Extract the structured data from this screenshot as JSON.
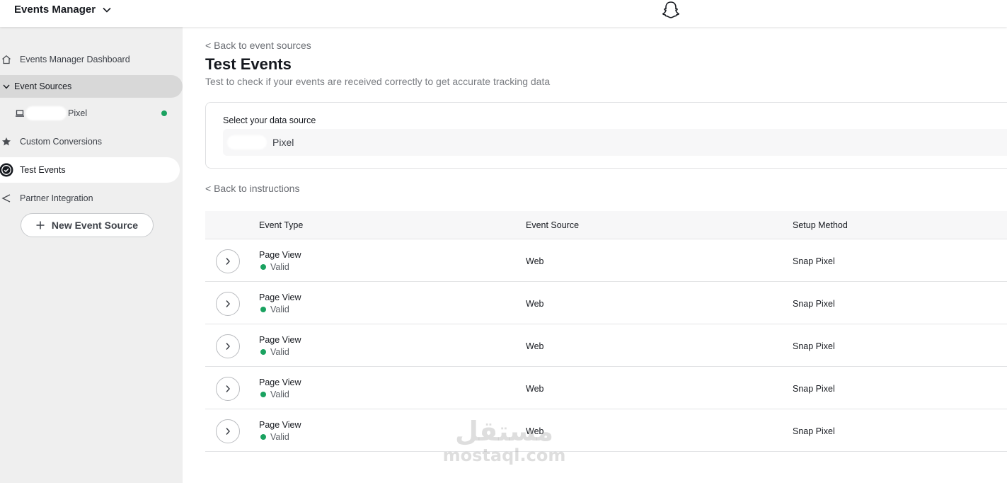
{
  "header": {
    "app_title": "Events Manager",
    "icons": [
      "chevron-down-icon",
      "snapchat-ghost-icon"
    ]
  },
  "sidebar": {
    "items": [
      {
        "label": "Events Manager Dashboard",
        "icon": "home-icon"
      },
      {
        "label": "Event Sources",
        "icon": "chevron-down-icon"
      },
      {
        "label": "Pixel",
        "icon": "laptop-icon",
        "status": "active"
      },
      {
        "label": "Custom Conversions",
        "icon": "star-icon"
      },
      {
        "label": "Test Events",
        "icon": "check-circle-icon"
      },
      {
        "label": "Partner Integration",
        "icon": "share-icon"
      }
    ],
    "new_button_label": "New Event Source"
  },
  "main": {
    "back_to_sources": "< Back to event sources",
    "title": "Test Events",
    "subtitle": "Test to check if your events are received correctly to get accurate tracking data",
    "data_source": {
      "label": "Select your data source",
      "value": "Pixel"
    },
    "back_to_instructions": "< Back to instructions",
    "table": {
      "headers": [
        "Event Type",
        "Event Source",
        "Setup Method"
      ],
      "rows": [
        {
          "event_type": "Page View",
          "status": "Valid",
          "source": "Web",
          "method": "Snap Pixel"
        },
        {
          "event_type": "Page View",
          "status": "Valid",
          "source": "Web",
          "method": "Snap Pixel"
        },
        {
          "event_type": "Page View",
          "status": "Valid",
          "source": "Web",
          "method": "Snap Pixel"
        },
        {
          "event_type": "Page View",
          "status": "Valid",
          "source": "Web",
          "method": "Snap Pixel"
        },
        {
          "event_type": "Page View",
          "status": "Valid",
          "source": "Web",
          "method": "Snap Pixel"
        }
      ]
    }
  },
  "watermark": {
    "arabic": "مستقل",
    "latin": "mostaql.com"
  },
  "colors": {
    "valid_green": "#1aa260",
    "sidebar_bg": "#efefef",
    "active_bg": "#ffffff"
  }
}
